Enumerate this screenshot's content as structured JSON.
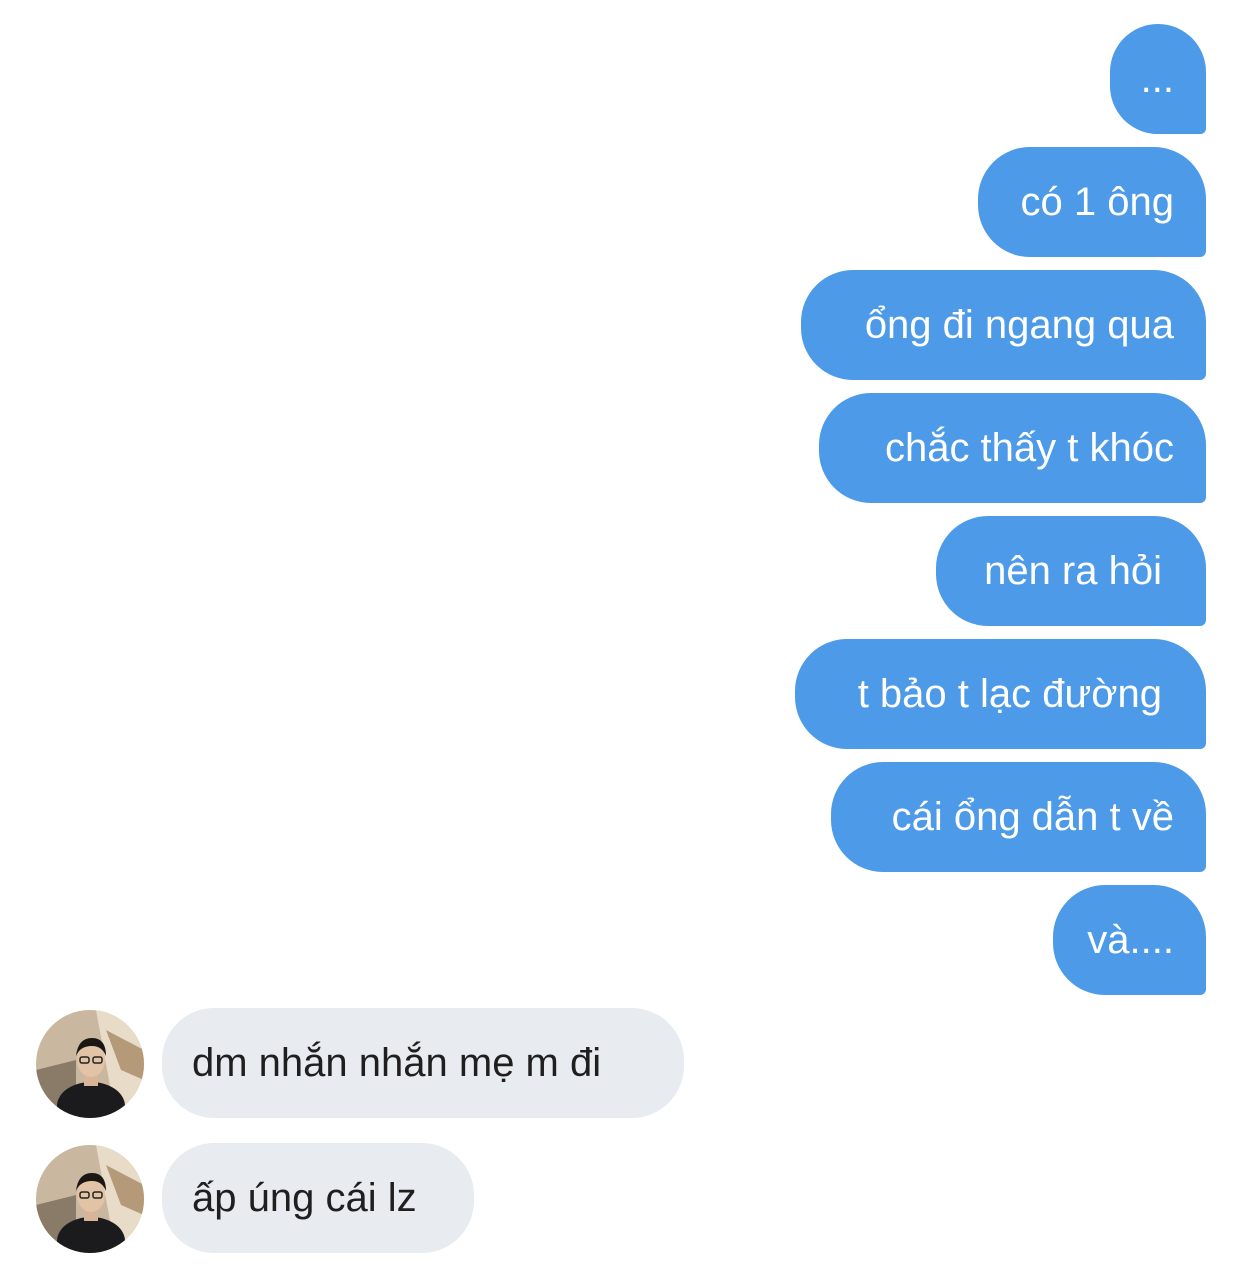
{
  "conversation": {
    "sent_messages": [
      {
        "text": "..."
      },
      {
        "text": "có 1 ông"
      },
      {
        "text": "ổng đi ngang qua"
      },
      {
        "text": "chắc thấy t khóc"
      },
      {
        "text": "nên ra hỏi"
      },
      {
        "text": "t bảo t lạc đường"
      },
      {
        "text": "cái ổng dẫn t về"
      },
      {
        "text": "và...."
      }
    ],
    "received_messages": [
      {
        "text": "dm nhắn nhắn mẹ m đi",
        "avatar": "avatar"
      },
      {
        "text": "ấp úng cái lz",
        "avatar": "avatar"
      }
    ]
  },
  "colors": {
    "sent_bubble": "#4c9ae8",
    "received_bubble": "#e8ebef",
    "background": "#ffffff"
  }
}
